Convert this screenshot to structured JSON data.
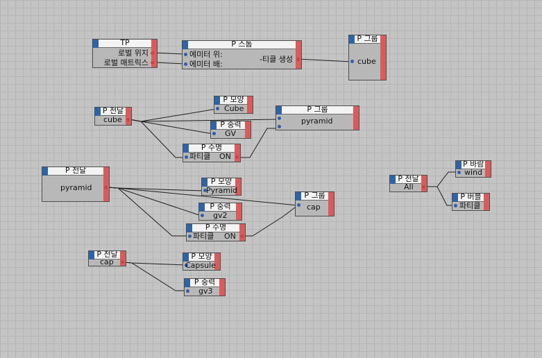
{
  "colors": {
    "canvas": "#c4c4c4",
    "grid": "#b5b5b5",
    "header_accent": "#2f63a3",
    "close_accent": "#d95c5c",
    "in_port": "#2f5fa8",
    "out_port": "#cc4444",
    "wire": "#1e1e1e"
  },
  "icons": {
    "header_left": "node-type-icon",
    "header_right": "node-close-icon"
  },
  "nodes": {
    "tp": {
      "title": "TP",
      "line1": "로벌 위지",
      "line2": "로벌 매트릭스"
    },
    "storm": {
      "title": "P 스톰",
      "line1": "에미터 위:",
      "line2": "에미터 배:",
      "right_label": "-티클 생성"
    },
    "group_cube": {
      "title": "P 그룹",
      "value": "cube"
    },
    "pass_cube": {
      "title": "P 전달",
      "value": "cube"
    },
    "shape_cube": {
      "title": "P 모양",
      "value": "Cube"
    },
    "group_pyramid": {
      "title": "P 그룹",
      "value": "pyramid"
    },
    "gravity_gv": {
      "title": "P 중력",
      "value": "GV"
    },
    "life_1": {
      "title": "P 수명",
      "value": "파티클",
      "value2": "ON"
    },
    "pass_pyramid": {
      "title": "P 전달",
      "value": "pyramid"
    },
    "shape_pyramid": {
      "title": "P 모양",
      "value": "Pyramid"
    },
    "group_cap": {
      "title": "P 그룹",
      "value": "cap"
    },
    "gravity_gv2": {
      "title": "P 중력",
      "value": "gv2"
    },
    "life_2": {
      "title": "P 수명",
      "value": "파티클",
      "value2": "ON"
    },
    "pass_all": {
      "title": "P 전달",
      "value": "All"
    },
    "wind": {
      "title": "P 바람",
      "value": "wind"
    },
    "bubble": {
      "title": "P 버블",
      "value": "파티클"
    },
    "pass_cap": {
      "title": "P 전달",
      "value": "cap"
    },
    "shape_capsule": {
      "title": "P 모양",
      "value": "Capsule"
    },
    "gravity_gv3": {
      "title": "P 중력",
      "value": "gv3"
    }
  }
}
